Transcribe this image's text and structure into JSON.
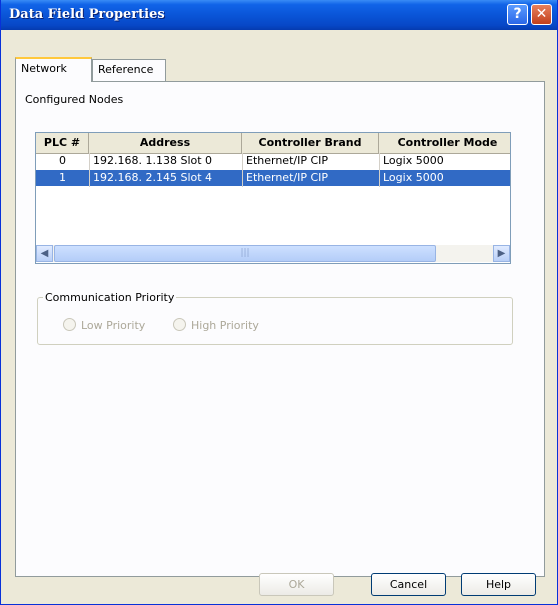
{
  "window": {
    "title": "Data Field Properties",
    "help_glyph": "?",
    "close_glyph": "✕"
  },
  "tabs": [
    {
      "label": "Network",
      "active": true
    },
    {
      "label": "Reference",
      "active": false
    }
  ],
  "configured_nodes_label": "Configured Nodes",
  "table": {
    "columns": [
      "PLC #",
      "Address",
      "Controller Brand",
      "Controller Mode"
    ],
    "rows": [
      {
        "plc": "0",
        "address": "192.168.  1.138 Slot 0",
        "brand": "Ethernet/IP CIP",
        "model": "Logix 5000",
        "selected": false
      },
      {
        "plc": "1",
        "address": "192.168.  2.145 Slot 4",
        "brand": "Ethernet/IP CIP",
        "model": "Logix 5000",
        "selected": true
      }
    ]
  },
  "scrollbar": {
    "left_glyph": "◀",
    "right_glyph": "▶",
    "thumb_grip": "|||"
  },
  "communication": {
    "legend": "Communication Priority",
    "options": [
      {
        "label": "Low Priority",
        "enabled": false
      },
      {
        "label": "High Priority",
        "enabled": false
      }
    ]
  },
  "buttons": {
    "ok": "OK",
    "cancel": "Cancel",
    "help": "Help"
  },
  "colors": {
    "title_bar": "#0a55d8",
    "selection": "#316ac5",
    "tab_highlight": "#ffc83c"
  }
}
